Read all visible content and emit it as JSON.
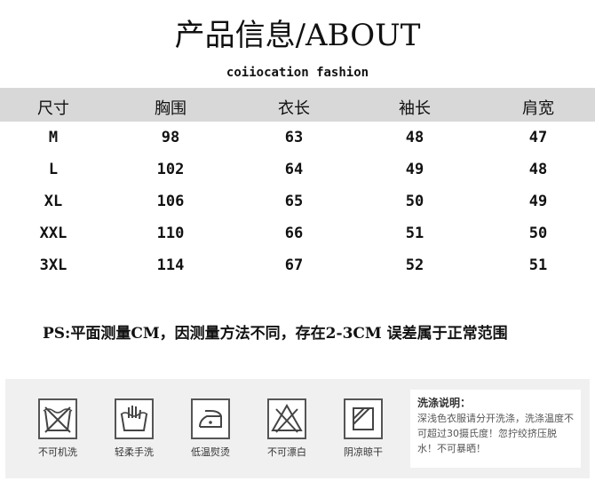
{
  "title": "产品信息/ABOUT",
  "subtitle": "coiiocation fashion",
  "table": {
    "headers": [
      "尺寸",
      "胸围",
      "衣长",
      "袖长",
      "肩宽"
    ],
    "rows": [
      [
        "M",
        "98",
        "63",
        "48",
        "47"
      ],
      [
        "L",
        "102",
        "64",
        "49",
        "48"
      ],
      [
        "XL",
        "106",
        "65",
        "50",
        "49"
      ],
      [
        "XXL",
        "110",
        "66",
        "51",
        "50"
      ],
      [
        "3XL",
        "114",
        "67",
        "52",
        "51"
      ]
    ]
  },
  "note": "PS:平面测量CM，因测量方法不同，存在2-3CM 误差属于正常范围",
  "care": {
    "items": [
      {
        "label": "不可机洗",
        "icon": "no-machine-wash-icon"
      },
      {
        "label": "轻柔手洗",
        "icon": "hand-wash-icon"
      },
      {
        "label": "低温熨烫",
        "icon": "low-iron-icon"
      },
      {
        "label": "不可漂白",
        "icon": "no-bleach-icon"
      },
      {
        "label": "阴凉晾干",
        "icon": "shade-dry-icon"
      }
    ],
    "wash_title": "洗涤说明：",
    "wash_text": "深浅色衣服请分开洗涤，洗涤温度不可超过30摄氏度！忽拧绞挤压脱水！不可暴晒！"
  }
}
